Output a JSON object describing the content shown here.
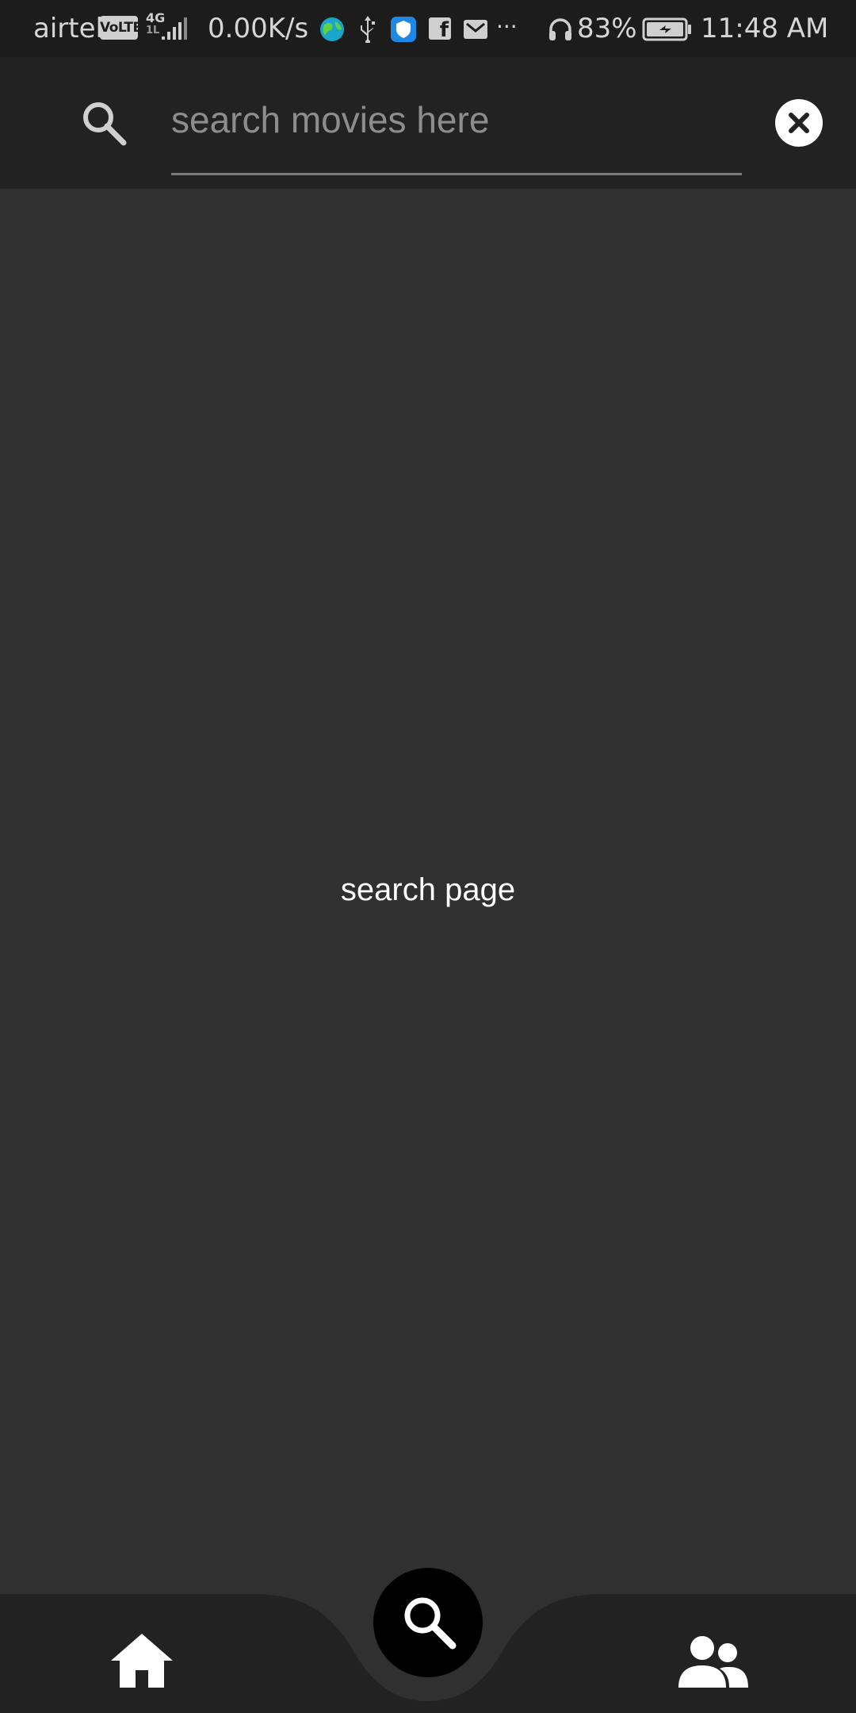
{
  "status_bar": {
    "carrier": "airtel",
    "volte_badge": "VoLTE",
    "network_type": "4G",
    "network_sub": "1L",
    "net_speed": "0.00K/s",
    "more_indicator": "···",
    "battery_percent": "83%",
    "time": "11:48 AM",
    "icons": [
      "signal-icon",
      "globe-icon",
      "usb-icon",
      "shield-icon",
      "facebook-icon",
      "mail-icon",
      "headphones-icon",
      "battery-charging-icon"
    ]
  },
  "search": {
    "placeholder": "search movies here",
    "value": "",
    "search_icon": "search-icon",
    "clear_icon": "close-icon"
  },
  "main": {
    "page_label": "search page"
  },
  "bottom_nav": {
    "items": [
      {
        "name": "home",
        "icon": "home-icon"
      },
      {
        "name": "search",
        "icon": "search-icon",
        "active": true
      },
      {
        "name": "people",
        "icon": "people-icon"
      }
    ]
  },
  "colors": {
    "status_bar_bg": "#1c1c1c",
    "header_bg": "#222222",
    "content_bg": "#303030",
    "nav_bg": "#222222",
    "fab_bg": "#000000",
    "text_primary": "#ffffff",
    "placeholder": "#8d8d8d"
  }
}
